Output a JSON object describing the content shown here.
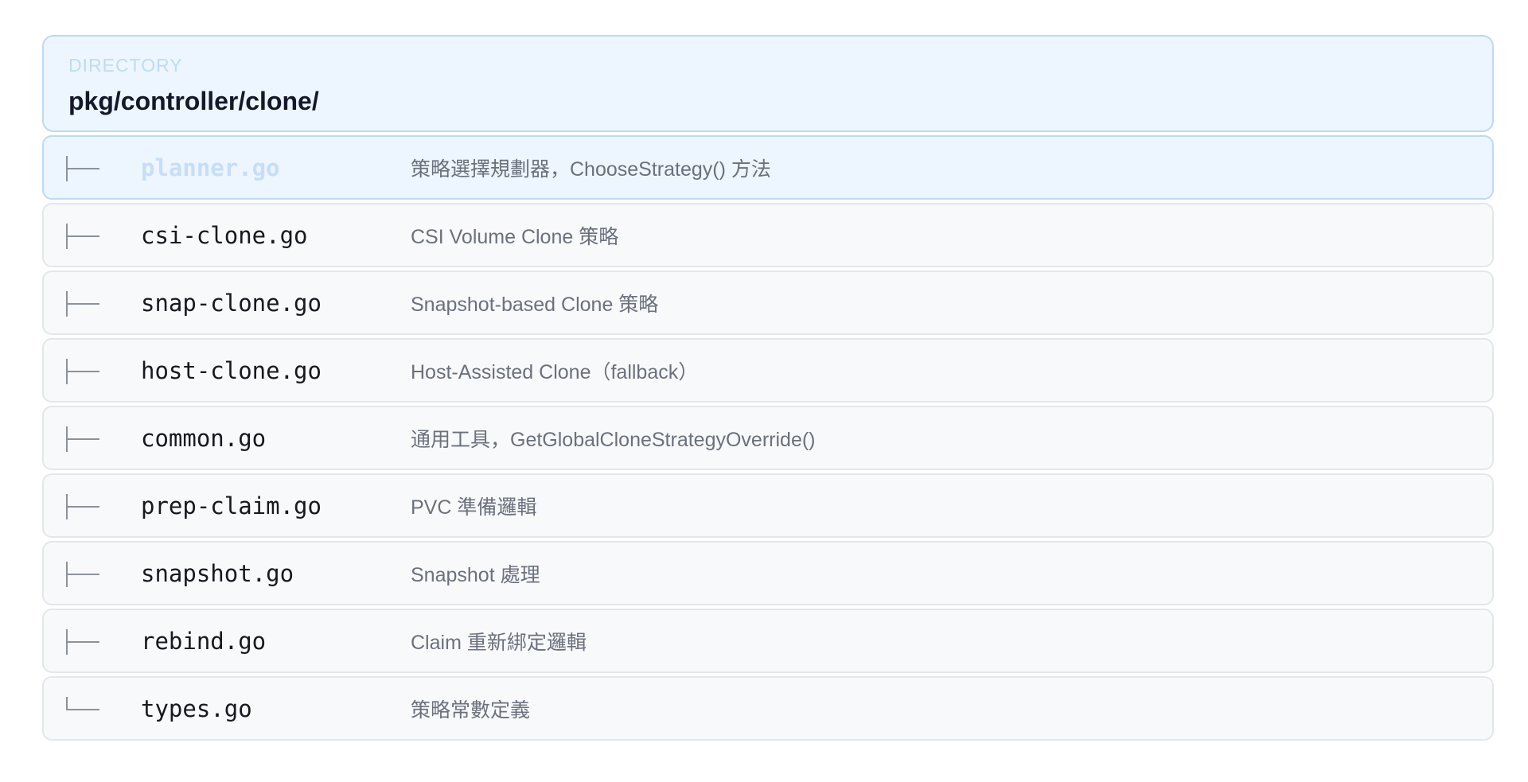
{
  "directory": {
    "label": "DIRECTORY",
    "path": "pkg/controller/clone/"
  },
  "files": [
    {
      "name": "planner.go",
      "desc": "策略選擇規劃器，ChooseStrategy() 方法",
      "active": true,
      "last": false
    },
    {
      "name": "csi-clone.go",
      "desc": "CSI Volume Clone 策略",
      "active": false,
      "last": false
    },
    {
      "name": "snap-clone.go",
      "desc": "Snapshot-based Clone 策略",
      "active": false,
      "last": false
    },
    {
      "name": "host-clone.go",
      "desc": "Host-Assisted Clone（fallback）",
      "active": false,
      "last": false
    },
    {
      "name": "common.go",
      "desc": "通用工具，GetGlobalCloneStrategyOverride()",
      "active": false,
      "last": false
    },
    {
      "name": "prep-claim.go",
      "desc": "PVC 準備邏輯",
      "active": false,
      "last": false
    },
    {
      "name": "snapshot.go",
      "desc": "Snapshot 處理",
      "active": false,
      "last": false
    },
    {
      "name": "rebind.go",
      "desc": "Claim 重新綁定邏輯",
      "active": false,
      "last": false
    },
    {
      "name": "types.go",
      "desc": "策略常數定義",
      "active": false,
      "last": true
    }
  ],
  "colors": {
    "active_bg": "#edf5fe",
    "active_border": "#bcdaf6",
    "row_bg": "#f8f9fb",
    "row_border": "#e4e7ea"
  }
}
